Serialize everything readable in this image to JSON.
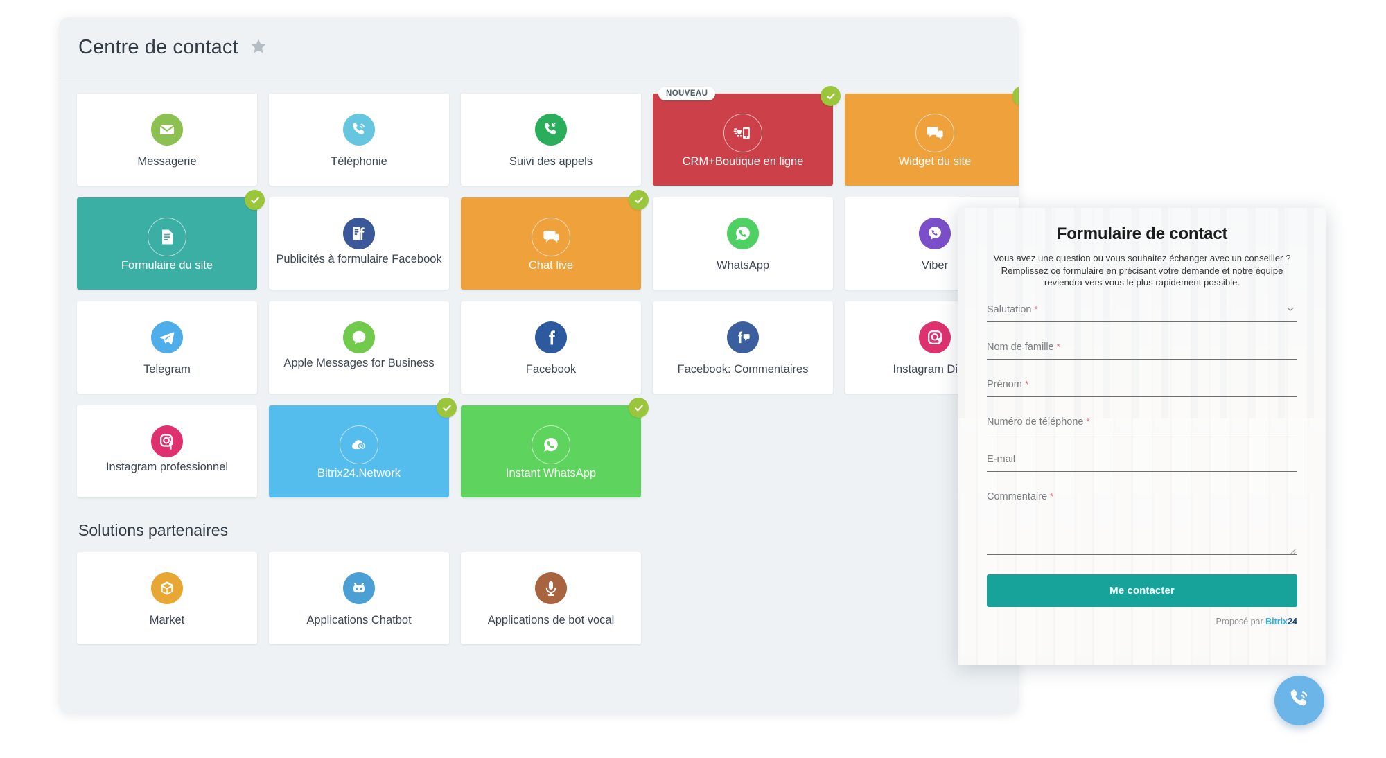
{
  "panel": {
    "title": "Centre de contact",
    "star_icon": "star-icon",
    "section_partners": "Solutions partenaires"
  },
  "badges": {
    "new_label": "NOUVEAU",
    "check_icon": "check-icon",
    "check_color": "#9bc63b",
    "new_text_color": "#51606e"
  },
  "tiles": [
    {
      "label": "Messagerie",
      "icon": "envelope-icon",
      "color": "#8cc152",
      "selected": false,
      "new": false,
      "style": "white"
    },
    {
      "label": "Téléphonie",
      "icon": "phone-ring-icon",
      "color": "#66c6e0",
      "selected": false,
      "new": false,
      "style": "white"
    },
    {
      "label": "Suivi des appels",
      "icon": "call-tracking-icon",
      "color": "#2bae5c",
      "selected": false,
      "new": false,
      "style": "white"
    },
    {
      "label": "CRM+Boutique en ligne",
      "icon": "online-store-icon",
      "color": "#cc4049",
      "selected": true,
      "new": true,
      "style": "filled"
    },
    {
      "label": "Widget du site",
      "icon": "chat-bubbles-icon",
      "color": "#efa23c",
      "selected": true,
      "new": false,
      "style": "filled"
    },
    {
      "label": "Formulaire du site",
      "icon": "form-document-icon",
      "color": "#3cafa5",
      "selected": true,
      "new": false,
      "style": "filled"
    },
    {
      "label": "Publicités à formulaire Facebook",
      "icon": "facebook-lead-form-icon",
      "color": "#3b5998",
      "selected": false,
      "new": false,
      "style": "white"
    },
    {
      "label": "Chat live",
      "icon": "live-chat-icon",
      "color": "#efa23c",
      "selected": true,
      "new": false,
      "style": "filled"
    },
    {
      "label": "WhatsApp",
      "icon": "whatsapp-icon",
      "color": "#4fd063",
      "selected": false,
      "new": false,
      "style": "white"
    },
    {
      "label": "Viber",
      "icon": "viber-icon",
      "color": "#7b4fc9",
      "selected": false,
      "new": false,
      "style": "white"
    },
    {
      "label": "Telegram",
      "icon": "telegram-icon",
      "color": "#4fadea",
      "selected": false,
      "new": false,
      "style": "white"
    },
    {
      "label": "Apple Messages for Business",
      "icon": "apple-messages-icon",
      "color": "#72ca4c",
      "selected": false,
      "new": false,
      "style": "white"
    },
    {
      "label": "Facebook",
      "icon": "facebook-icon",
      "color": "#2d5a9e",
      "selected": false,
      "new": false,
      "style": "white"
    },
    {
      "label": "Facebook: Commentaires",
      "icon": "facebook-comments-icon",
      "color": "#3b5f9e",
      "selected": false,
      "new": false,
      "style": "white"
    },
    {
      "label": "Instagram Direct",
      "icon": "instagram-direct-icon",
      "color": "#e0316f",
      "selected": false,
      "new": false,
      "style": "white"
    },
    {
      "label": "Instagram professionnel",
      "icon": "instagram-business-icon",
      "color": "#e0316f",
      "selected": false,
      "new": false,
      "style": "white"
    },
    {
      "label": "Bitrix24.Network",
      "icon": "cloud-network-icon",
      "color": "#55bded",
      "selected": true,
      "new": false,
      "style": "filled"
    },
    {
      "label": "Instant WhatsApp",
      "icon": "whatsapp-icon",
      "color": "#5ed45e",
      "selected": true,
      "new": false,
      "style": "filled"
    }
  ],
  "partner_tiles": [
    {
      "label": "Market",
      "icon": "box-icon",
      "color": "#e8a735"
    },
    {
      "label": "Applications Chatbot",
      "icon": "robot-icon",
      "color": "#4a9fd4"
    },
    {
      "label": "Applications de bot vocal",
      "icon": "microphone-icon",
      "color": "#a8643f"
    }
  ],
  "form": {
    "title": "Formulaire de contact",
    "description": "Vous avez une question ou vous souhaitez échanger avec un conseiller ? Remplissez ce formulaire en précisant votre demande et notre équipe reviendra vers vous le plus rapidement possible.",
    "fields": [
      {
        "label": "Salutation",
        "required": true,
        "type": "select",
        "value": ""
      },
      {
        "label": "Nom de famille",
        "required": true,
        "type": "text",
        "value": ""
      },
      {
        "label": "Prénom",
        "required": true,
        "type": "text",
        "value": ""
      },
      {
        "label": "Numéro de téléphone",
        "required": true,
        "type": "tel",
        "value": ""
      },
      {
        "label": "E-mail",
        "required": false,
        "type": "email",
        "value": ""
      },
      {
        "label": "Commentaire",
        "required": true,
        "type": "textarea",
        "value": ""
      }
    ],
    "submit_label": "Me contacter",
    "footer_prefix": "Proposé par",
    "footer_brand": "Bitrix",
    "footer_brand_num": "24",
    "accent_color": "#17a39a",
    "required_mark": "*"
  },
  "fab": {
    "icon": "phone-call-icon",
    "color": "#6cb5e9"
  }
}
